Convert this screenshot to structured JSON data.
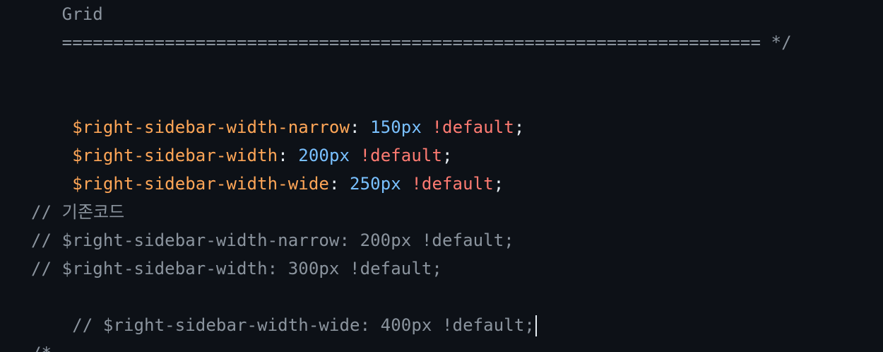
{
  "editor": {
    "lines": [
      {
        "text": "   Grid"
      },
      {
        "text": "   ==================================================================== */"
      },
      {
        "text": ""
      },
      {
        "var": "$right-sidebar-width-narrow",
        "colon": ": ",
        "value": "150px",
        "flag": "!default",
        "semi": ";"
      },
      {
        "var": "$right-sidebar-width",
        "colon": ": ",
        "value": "200px",
        "flag": "!default",
        "semi": ";"
      },
      {
        "var": "$right-sidebar-width-wide",
        "colon": ": ",
        "value": "250px",
        "flag": "!default",
        "semi": ";"
      },
      {
        "text": ""
      },
      {
        "text": "// 기존코드"
      },
      {
        "text": "// $right-sidebar-width-narrow: 200px !default;"
      },
      {
        "text": "// $right-sidebar-width: 300px !default;"
      },
      {
        "text": "// $right-sidebar-width-wide: 400px !default;"
      },
      {
        "text": ""
      },
      {
        "text": "/*"
      }
    ]
  }
}
